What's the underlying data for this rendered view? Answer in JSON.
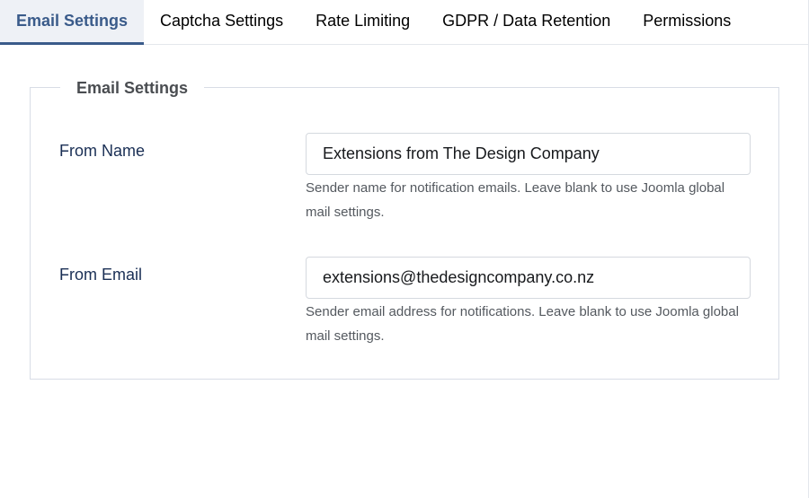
{
  "tabs": [
    {
      "label": "Email Settings",
      "active": true
    },
    {
      "label": "Captcha Settings",
      "active": false
    },
    {
      "label": "Rate Limiting",
      "active": false
    },
    {
      "label": "GDPR / Data Retention",
      "active": false
    },
    {
      "label": "Permissions",
      "active": false
    }
  ],
  "fieldset": {
    "legend": "Email Settings",
    "fields": [
      {
        "label": "From Name",
        "value": "Extensions from The Design Company",
        "help": "Sender name for notification emails. Leave blank to use Joomla global mail settings."
      },
      {
        "label": "From Email",
        "value": "extensions@thedesigncompany.co.nz",
        "help": "Sender email address for notifications. Leave blank to use Joomla global mail settings."
      }
    ]
  },
  "colors": {
    "accent": "#3a5b8a",
    "active_tab_bg": "#eef1f6",
    "label": "#1a2f55",
    "help": "#54595f"
  }
}
